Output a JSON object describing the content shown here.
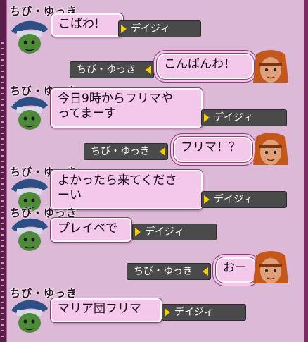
{
  "messages": [
    {
      "side": "left",
      "speaker": "ちび・ゆっき",
      "text": "こばわ!",
      "target": "デイジィ"
    },
    {
      "side": "right",
      "text": "こんばんわ！",
      "target": "ちび・ゆっき"
    },
    {
      "side": "left",
      "speaker": "ちび・ゆっき",
      "text_lines": [
        "今日9時からフリマや",
        "ってまーす"
      ],
      "target": "デイジィ"
    },
    {
      "side": "right",
      "text": "フリマ！？",
      "target": "ちび・ゆっき"
    },
    {
      "side": "left",
      "speaker": "ちび・ゆっき",
      "text_lines": [
        "よかったら来てくださ",
        "ーい"
      ],
      "target": "デイジィ"
    },
    {
      "side": "left",
      "speaker": "ちび・ゆっき",
      "text": "プレイベで",
      "target": "デイジィ"
    },
    {
      "side": "right",
      "text": "おー",
      "target": "ちび・ゆっき"
    },
    {
      "side": "left",
      "speaker": "ちび・ゆっき",
      "text": "マリア団フリマ",
      "target": "デイジィ"
    }
  ],
  "colors": {
    "bubble": "#f3c8eb",
    "tag_bg": "#4a4a4a",
    "arrow": "#f5d000",
    "panel": "#dcb9d6"
  },
  "icons": {
    "left_avatar": "green-goblin-blue-hat-avatar",
    "right_avatar": "red-haired-elf-avatar"
  }
}
